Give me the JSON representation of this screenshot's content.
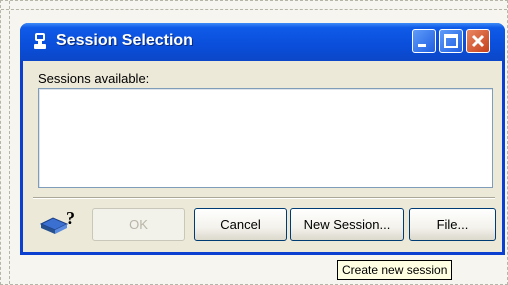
{
  "window": {
    "title": "Session Selection",
    "title_icon": "session-icon",
    "controls": [
      "minimize-icon",
      "maximize-icon",
      "close-icon"
    ]
  },
  "sessions": {
    "label": "Sessions available:",
    "items": []
  },
  "buttons": {
    "help_icon": "help-book-icon",
    "ok": "OK",
    "cancel": "Cancel",
    "new_session": "New Session...",
    "file": "File..."
  },
  "tooltip": {
    "text": "Create new session"
  },
  "colors": {
    "titlebar": "#0a4fdc",
    "window_bg": "#ece9d8",
    "close_button": "#c5401c",
    "tooltip_bg": "#ffffe1"
  }
}
